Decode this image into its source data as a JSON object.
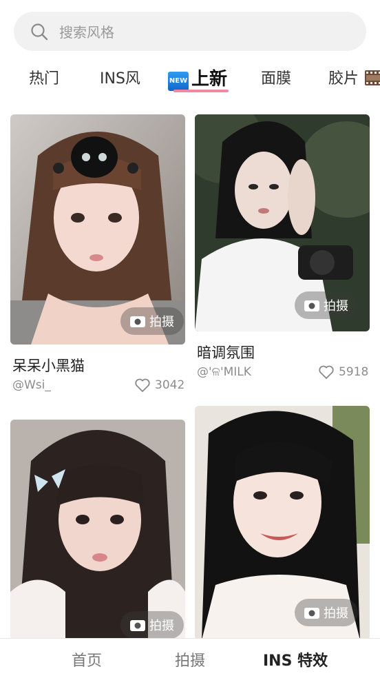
{
  "search": {
    "placeholder": "搜索风格"
  },
  "tabs": [
    {
      "label": "热门"
    },
    {
      "label": "INS风"
    },
    {
      "label": "上新",
      "badge": "NEW",
      "active": true
    },
    {
      "label": "面膜"
    },
    {
      "label": "胶片"
    }
  ],
  "cards": [
    {
      "title": "呆呆小黑猫",
      "author": "@Wsi_",
      "likes": "3042",
      "action": "拍摄"
    },
    {
      "title": "暗调氛围",
      "author": "@'ଳ'MILK",
      "likes": "5918",
      "action": "拍摄"
    },
    {
      "title": "",
      "author": "",
      "likes": "",
      "action": "拍摄"
    },
    {
      "title": "",
      "author": "",
      "likes": "",
      "action": "拍摄"
    }
  ],
  "bottom_nav": [
    {
      "label": "首页"
    },
    {
      "label": "拍摄"
    },
    {
      "label": "INS 特效",
      "active": true
    }
  ],
  "colors": {
    "tab_underline": "#f08aa0",
    "search_bg": "#f1f1f1"
  }
}
